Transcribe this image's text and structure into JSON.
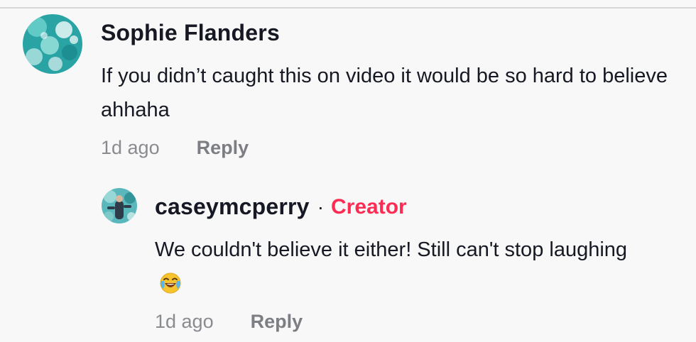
{
  "comment": {
    "author": "Sophie Flanders",
    "text": "If you didn’t caught this on video it would be so hard to believe ahhaha",
    "timestamp": "1d ago",
    "reply_label": "Reply"
  },
  "reply": {
    "author": "caseymcperry",
    "separator": "·",
    "badge": "Creator",
    "text": "We couldn't believe it either! Still can't stop laughing",
    "emoji": "face-with-tears-of-joy",
    "timestamp": "1d ago",
    "reply_label": "Reply"
  },
  "colors": {
    "background": "#f8f8f8",
    "text": "#161823",
    "muted": "#8a8b91",
    "creator_accent": "#fe2c55",
    "avatar_main": "#2fa8a8",
    "avatar_reply": "#4fb3b8"
  }
}
